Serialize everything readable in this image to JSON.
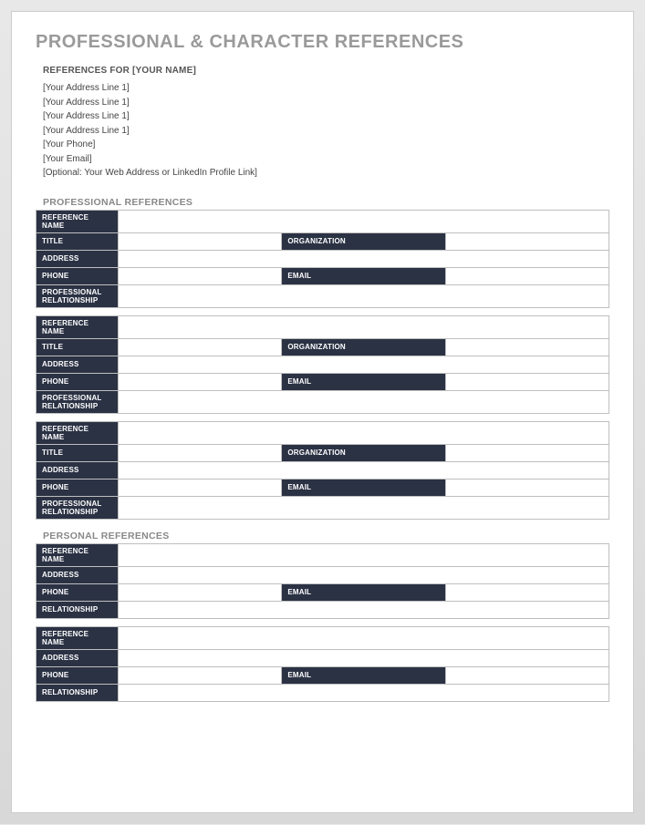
{
  "title": "PROFESSIONAL & CHARACTER REFERENCES",
  "subheading": "REFERENCES FOR [YOUR NAME]",
  "address_lines": [
    "[Your Address Line 1]",
    "[Your Address Line 1]",
    "[Your Address Line 1]",
    "[Your Address Line 1]",
    "[Your Phone]",
    "[Your Email]",
    "[Optional: Your Web Address or LinkedIn Profile Link]"
  ],
  "sections": {
    "professional": {
      "label": "PROFESSIONAL REFERENCES",
      "fields": {
        "reference_name": "REFERENCE NAME",
        "title": "TITLE",
        "organization": "ORGANIZATION",
        "address": "ADDRESS",
        "phone": "PHONE",
        "email": "EMAIL",
        "relationship": "PROFESSIONAL RELATIONSHIP"
      },
      "entries": [
        {
          "reference_name": "",
          "title": "",
          "organization": "",
          "address": "",
          "phone": "",
          "email": "",
          "relationship": ""
        },
        {
          "reference_name": "",
          "title": "",
          "organization": "",
          "address": "",
          "phone": "",
          "email": "",
          "relationship": ""
        },
        {
          "reference_name": "",
          "title": "",
          "organization": "",
          "address": "",
          "phone": "",
          "email": "",
          "relationship": ""
        }
      ]
    },
    "personal": {
      "label": "PERSONAL REFERENCES",
      "fields": {
        "reference_name": "REFERENCE NAME",
        "address": "ADDRESS",
        "phone": "PHONE",
        "email": "EMAIL",
        "relationship": "RELATIONSHIP"
      },
      "entries": [
        {
          "reference_name": "",
          "address": "",
          "phone": "",
          "email": "",
          "relationship": ""
        },
        {
          "reference_name": "",
          "address": "",
          "phone": "",
          "email": "",
          "relationship": ""
        }
      ]
    }
  }
}
